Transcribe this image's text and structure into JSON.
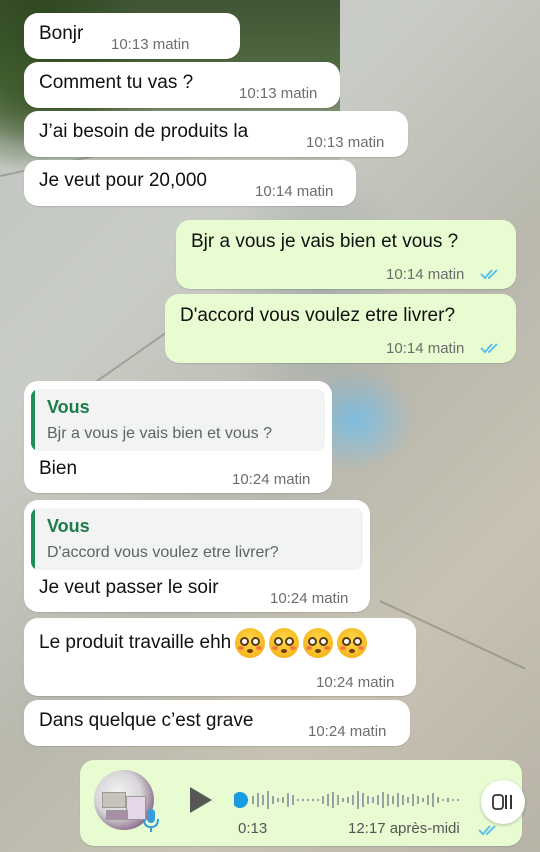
{
  "messages": [
    {
      "text": "Bonjr",
      "time": "10:13 matin"
    },
    {
      "text": "Comment tu vas ?",
      "time": "10:13 matin"
    },
    {
      "text": "J’ai besoin de produits la",
      "time": "10:13 matin"
    },
    {
      "text": "Je veut pour 20,000",
      "time": "10:14 matin"
    },
    {
      "text": "Bjr a vous je vais bien et vous ?",
      "time": "10:14 matin"
    },
    {
      "text": "D'accord vous voulez etre livrer?",
      "time": "10:14 matin"
    },
    {
      "quote_author": "Vous",
      "quote_text": "Bjr a vous je vais bien et vous ?",
      "text": "Bien",
      "time": "10:24 matin"
    },
    {
      "quote_author": "Vous",
      "quote_text": "D'accord vous voulez etre livrer?",
      "text": "Je veut passer le soir",
      "time": "10:24 matin"
    },
    {
      "text": "Le produit travaille ehh",
      "emoji": "flushed-face",
      "emoji_count": 4,
      "time": "10:24 matin"
    },
    {
      "text": "Dans quelque c’est grave",
      "time": "10:24 matin"
    }
  ],
  "voice_message": {
    "duration": "0:13",
    "time": "12:17 après-midi",
    "progress": 0
  },
  "colors": {
    "incoming_bubble": "#ffffff",
    "outgoing_bubble": "#e7fcd1",
    "read_ticks": "#53bdeb",
    "quote_author": "#1f7a4c",
    "time_text": "#6d6d6d"
  }
}
